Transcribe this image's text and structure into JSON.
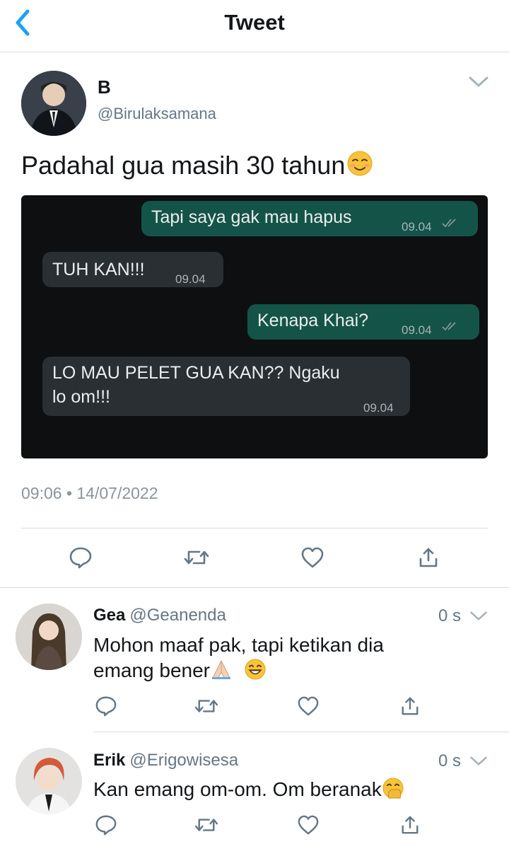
{
  "header": {
    "title": "Tweet"
  },
  "tweet": {
    "display_name": "B",
    "handle": "@Birulaksamana",
    "text": "Padahal gua masih 30 tahun",
    "timestamp": "09:06 • 14/07/2022",
    "chat": [
      {
        "direction": "out",
        "text": "Tapi saya gak mau hapus",
        "time": "09.04"
      },
      {
        "direction": "in",
        "text": "TUH KAN!!!",
        "time": "09.04"
      },
      {
        "direction": "out",
        "text": "Kenapa Khai?",
        "time": "09.04"
      },
      {
        "direction": "in",
        "text_line1": "LO MAU PELET GUA KAN?? Ngaku",
        "text_line2": "lo om!!!",
        "time": "09.04"
      }
    ]
  },
  "replies": [
    {
      "name": "Gea",
      "handle": "@Geanenda",
      "age": "0 s",
      "text_line1": "Mohon maaf pak, tapi ketikan dia",
      "text_line2": "emang bener"
    },
    {
      "name": "Erik",
      "handle": "@Erigowisesa",
      "age": "0 s",
      "text_line1": "Kan emang om-om. Om beranak"
    }
  ],
  "icons": [
    "back-chevron-icon",
    "chevron-down-icon",
    "reply-icon",
    "retweet-icon",
    "like-icon",
    "share-icon"
  ],
  "colors": {
    "accent": "#1da1f2",
    "chat_outgoing": "#145448",
    "chat_incoming": "#2a2f33"
  }
}
